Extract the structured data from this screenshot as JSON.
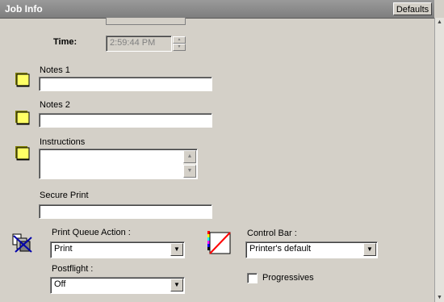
{
  "header": {
    "title": "Job Info",
    "defaults_label": "Defaults"
  },
  "time": {
    "label": "Time:",
    "value": "2:59:44 PM"
  },
  "notes1": {
    "label": "Notes 1",
    "value": ""
  },
  "notes2": {
    "label": "Notes 2",
    "value": ""
  },
  "instructions": {
    "label": "Instructions",
    "value": ""
  },
  "secure_print": {
    "label": "Secure Print",
    "value": ""
  },
  "print_queue_action": {
    "label": "Print Queue Action :",
    "value": "Print"
  },
  "postflight": {
    "label": "Postflight :",
    "value": "Off"
  },
  "control_bar": {
    "label": "Control Bar :",
    "value": "Printer's default"
  },
  "progressives": {
    "label": "Progressives",
    "checked": false
  },
  "icons": {
    "note": "sticky-note-icon",
    "queue": "print-queue-icon",
    "control_bar": "control-bar-icon"
  }
}
